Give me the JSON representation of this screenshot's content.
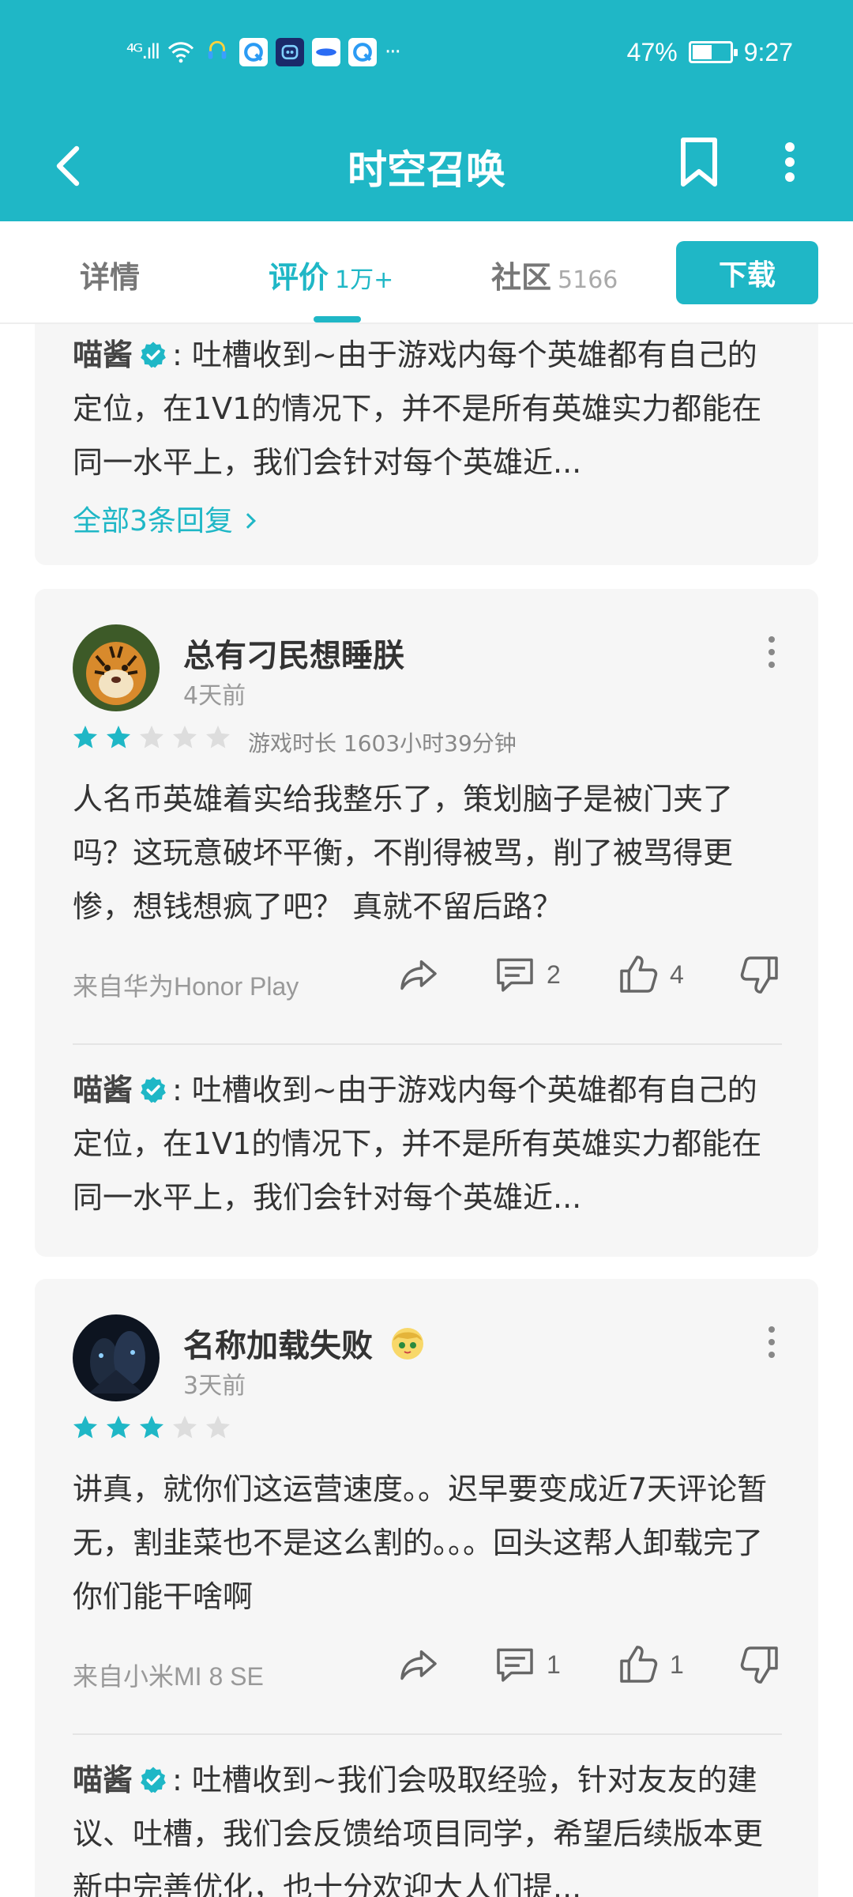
{
  "status_bar": {
    "signal": "⁴ᴳ.ıll",
    "battery_percent": "47%",
    "time": "9:27",
    "app_icon_names": [
      "wifi-icon",
      "headset-icon",
      "notify-app-icon",
      "bot-app-icon",
      "chat-app-icon",
      "browser-app-icon"
    ],
    "overflow": "···"
  },
  "header": {
    "title": "时空召唤"
  },
  "tabs": [
    {
      "label": "详情",
      "count": ""
    },
    {
      "label": "评价",
      "count": "1万+"
    },
    {
      "label": "社区",
      "count": "5166"
    }
  ],
  "download_label": "下载",
  "colors": {
    "accent": "#1fb7c6",
    "star_on": "#1fb7c6",
    "star_off": "#dddddd"
  },
  "reviews": [
    {
      "reply": {
        "author": "喵酱",
        "text": ": 吐槽收到~由于游戏内每个英雄都有自己的定位，在1V1的情况下，并不是所有英雄实力都能在同一水平上，我们会针对每个英雄近..."
      },
      "more_replies": "全部3条回复"
    },
    {
      "user": "总有刁民想睡朕",
      "time": "4天前",
      "rating": 2,
      "playtime": "游戏时长 1603小时39分钟",
      "text": "人名币英雄着实给我整乐了，策划脑子是被门夹了吗？这玩意破坏平衡，不削得被骂，削了被骂得更惨，想钱想疯了吧？ 真就不留后路？",
      "device": "来自华为Honor Play",
      "comments": "2",
      "likes": "4",
      "reply": {
        "author": "喵酱",
        "text": ": 吐槽收到~由于游戏内每个英雄都有自己的定位，在1V1的情况下，并不是所有英雄实力都能在同一水平上，我们会针对每个英雄近..."
      }
    },
    {
      "user": "名称加载失败",
      "time": "3天前",
      "rating": 3,
      "playtime": "",
      "text": "讲真，就你们这运营速度。。迟早要变成近7天评论暂无，割韭菜也不是这么割的。。。回头这帮人卸载完了你们能干啥啊",
      "device": "来自小米MI 8 SE",
      "comments": "1",
      "likes": "1",
      "reply": {
        "author": "喵酱",
        "text": ": 吐槽收到~我们会吸取经验，针对友友的建议、吐槽，我们会反馈给项目同学，希望后续版本更新中完善优化，也十分欢迎大人们提..."
      }
    }
  ]
}
